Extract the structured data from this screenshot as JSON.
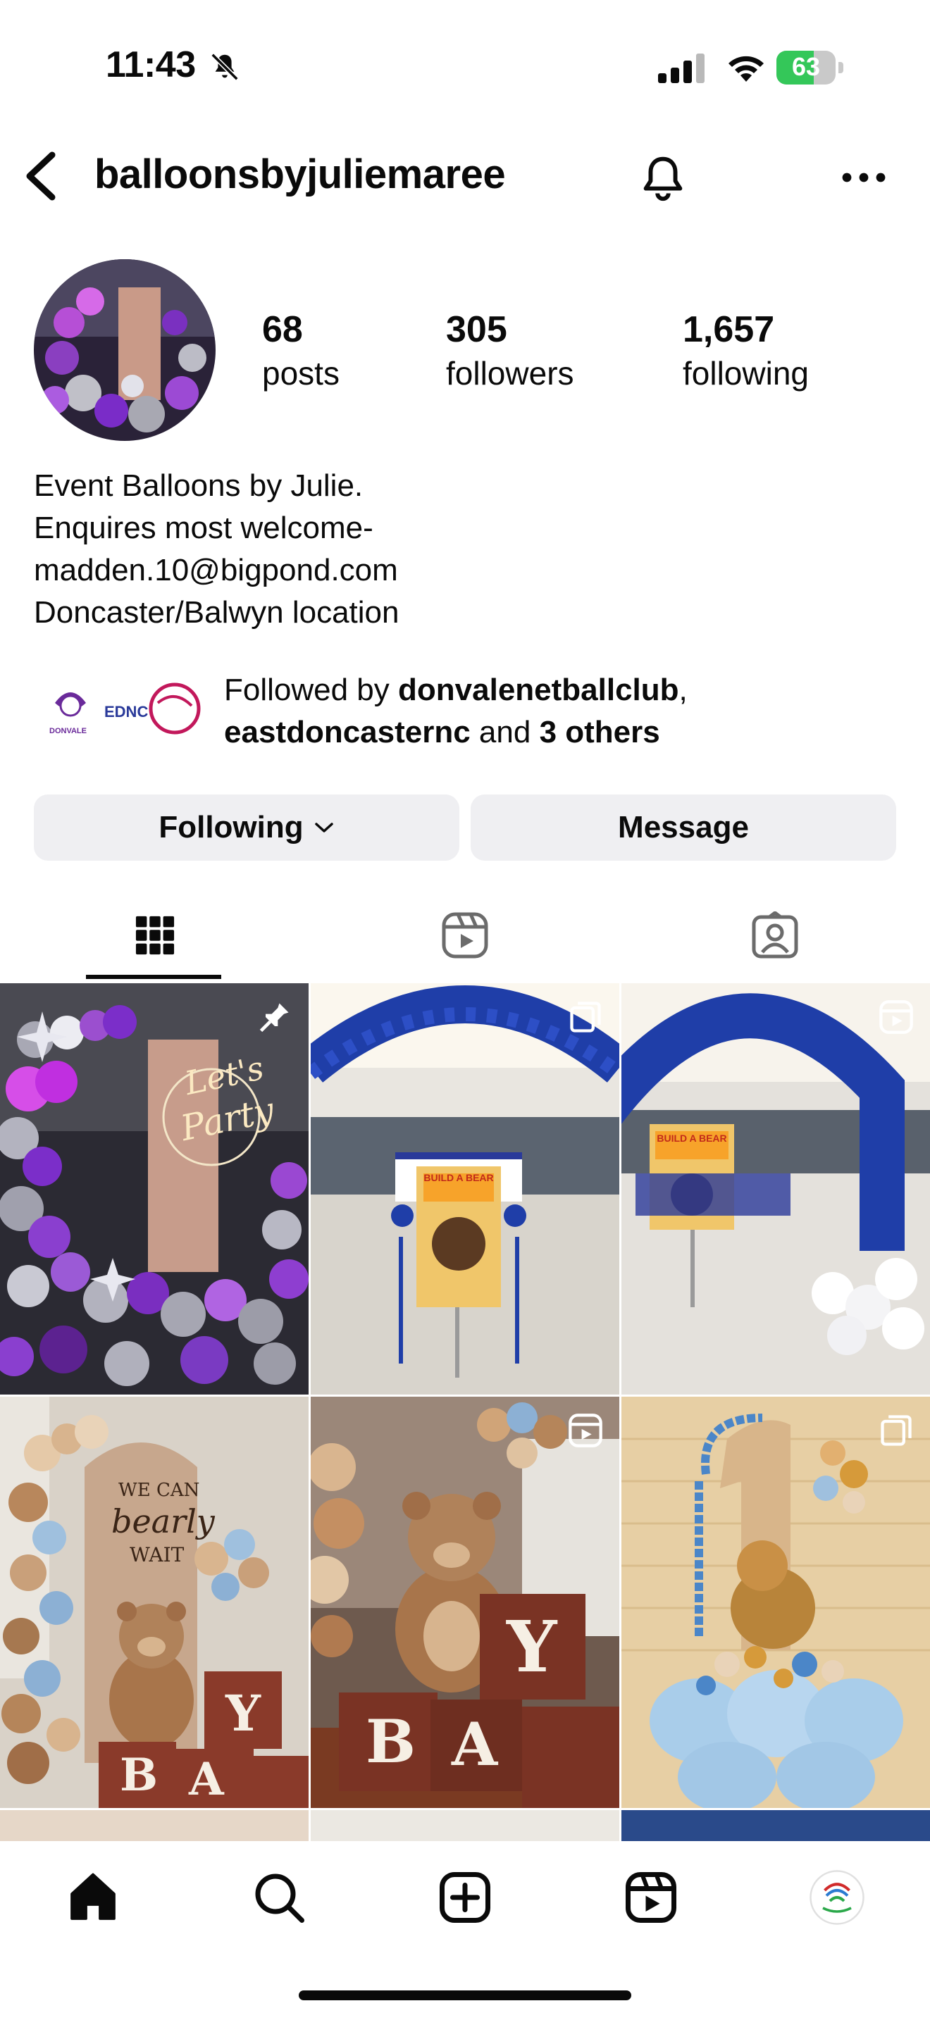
{
  "status_bar": {
    "time": "11:43",
    "battery": "63",
    "battery_level": 0.63
  },
  "header": {
    "username": "balloonsbyjuliemaree"
  },
  "stats": [
    {
      "value": "68",
      "label": "posts"
    },
    {
      "value": "305",
      "label": "followers"
    },
    {
      "value": "1,657",
      "label": "following"
    }
  ],
  "bio": {
    "line1": "Event Balloons by Julie.",
    "line2": "Enquires most welcome-",
    "line3": "madden.10@bigpond.com",
    "line4": "Doncaster/Balwyn location"
  },
  "followed_by": {
    "prefix": "Followed by ",
    "user1": "donvalenetballclub",
    "sep": ",",
    "user2": "eastdoncasternc",
    "and": " and ",
    "others": "3 others",
    "avatar1_text": "DONVALE",
    "avatar2_text": "EDNC"
  },
  "actions": {
    "following": "Following",
    "message": "Message"
  },
  "tabs": [
    "grid-icon",
    "reels-icon",
    "tagged-icon"
  ],
  "grid": {
    "posts": [
      {
        "badge": "pin-icon",
        "text1": "Let's",
        "text2": "Party"
      },
      {
        "badge": "carousel-icon",
        "sign": "BUILD A BEAR"
      },
      {
        "badge": "reel-icon",
        "sign": "BUILD A BEAR"
      },
      {
        "badge": "none",
        "text1": "WE CAN",
        "text2": "bearly",
        "text3": "WAIT",
        "blocks": [
          "Y",
          "A",
          "B"
        ]
      },
      {
        "badge": "reel-icon",
        "blocks": [
          "Y",
          "A",
          "B"
        ]
      },
      {
        "badge": "carousel-icon"
      }
    ]
  },
  "bottom_nav": [
    "home-icon",
    "search-icon",
    "create-icon",
    "reels-nav-icon",
    "profile-avatar"
  ],
  "colors": {
    "accent_blue": "#1f3ea8",
    "purple": "#7b2ec9",
    "brown": "#a8754b",
    "text": "#0a0a0a",
    "button_bg": "#efeff2"
  }
}
